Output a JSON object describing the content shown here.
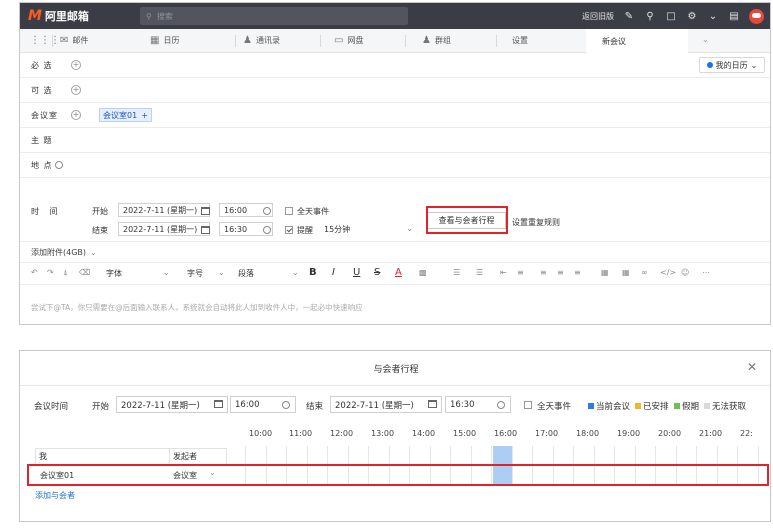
{
  "app": {
    "logo_text": "阿里邮箱",
    "search_placeholder": "搜索",
    "back_old": "返回旧版"
  },
  "nav": {
    "items": [
      "邮件",
      "日历",
      "通讯录",
      "网盘",
      "群组",
      "设置"
    ],
    "active_tab": "新会议"
  },
  "form": {
    "required_label": "必 选",
    "optional_label": "可 选",
    "room_label": "会议室",
    "room_chip": "会议室01",
    "subject_label": "主 题",
    "location_label": "地 点",
    "my_calendar": "我的日历",
    "time_label": "时 间",
    "start_label": "开始",
    "end_label": "结束",
    "start_date": "2022-7-11 (星期一)",
    "start_time": "16:00",
    "end_date": "2022-7-11 (星期一)",
    "end_time": "16:30",
    "allday_label": "全天事件",
    "remind_label": "提醒",
    "remind_value": "15分钟",
    "view_schedule_btn": "查看与会者行程",
    "repeat_label": "设置重复规则",
    "attach_label": "添加附件(4GB)",
    "editor_placeholder": "尝试下@TA，你只需要在@后面输入联系人，系统就会自动将此人加到收件人中，一起必中快速响应",
    "toolbar": {
      "font": "字体",
      "size": "字号",
      "spacing": "段落",
      "bold": "B",
      "italic": "I",
      "underline": "U",
      "strike": "S",
      "fontcolor": "A"
    }
  },
  "dialog": {
    "title": "与会者行程",
    "meeting_time_label": "会议时间",
    "start_label": "开始",
    "start_date": "2022-7-11 (星期一)",
    "start_time": "16:00",
    "end_label": "结束",
    "end_date": "2022-7-11 (星期一)",
    "end_time": "16:30",
    "allday_label": "全天事件",
    "legend": [
      {
        "label": "当前会议",
        "color": "#2d7be5"
      },
      {
        "label": "已安排",
        "color": "#f2b531"
      },
      {
        "label": "假期",
        "color": "#6cc24a"
      },
      {
        "label": "无法获取",
        "color": "#d9d9d9"
      }
    ],
    "hours": [
      "10:00",
      "11:00",
      "12:00",
      "13:00",
      "14:00",
      "15:00",
      "16:00",
      "17:00",
      "18:00",
      "19:00",
      "20:00",
      "21:00",
      "22:"
    ],
    "col_me": "我",
    "col_organizer": "发起者",
    "row_name": "会议室01",
    "row_role": "会议室",
    "add_attendee": "添加与会者"
  },
  "colors": {
    "topbar": "#3a3d45",
    "logo": "#ff5a1f",
    "highlight": "#e0242e",
    "busy": "#aecdf5"
  }
}
